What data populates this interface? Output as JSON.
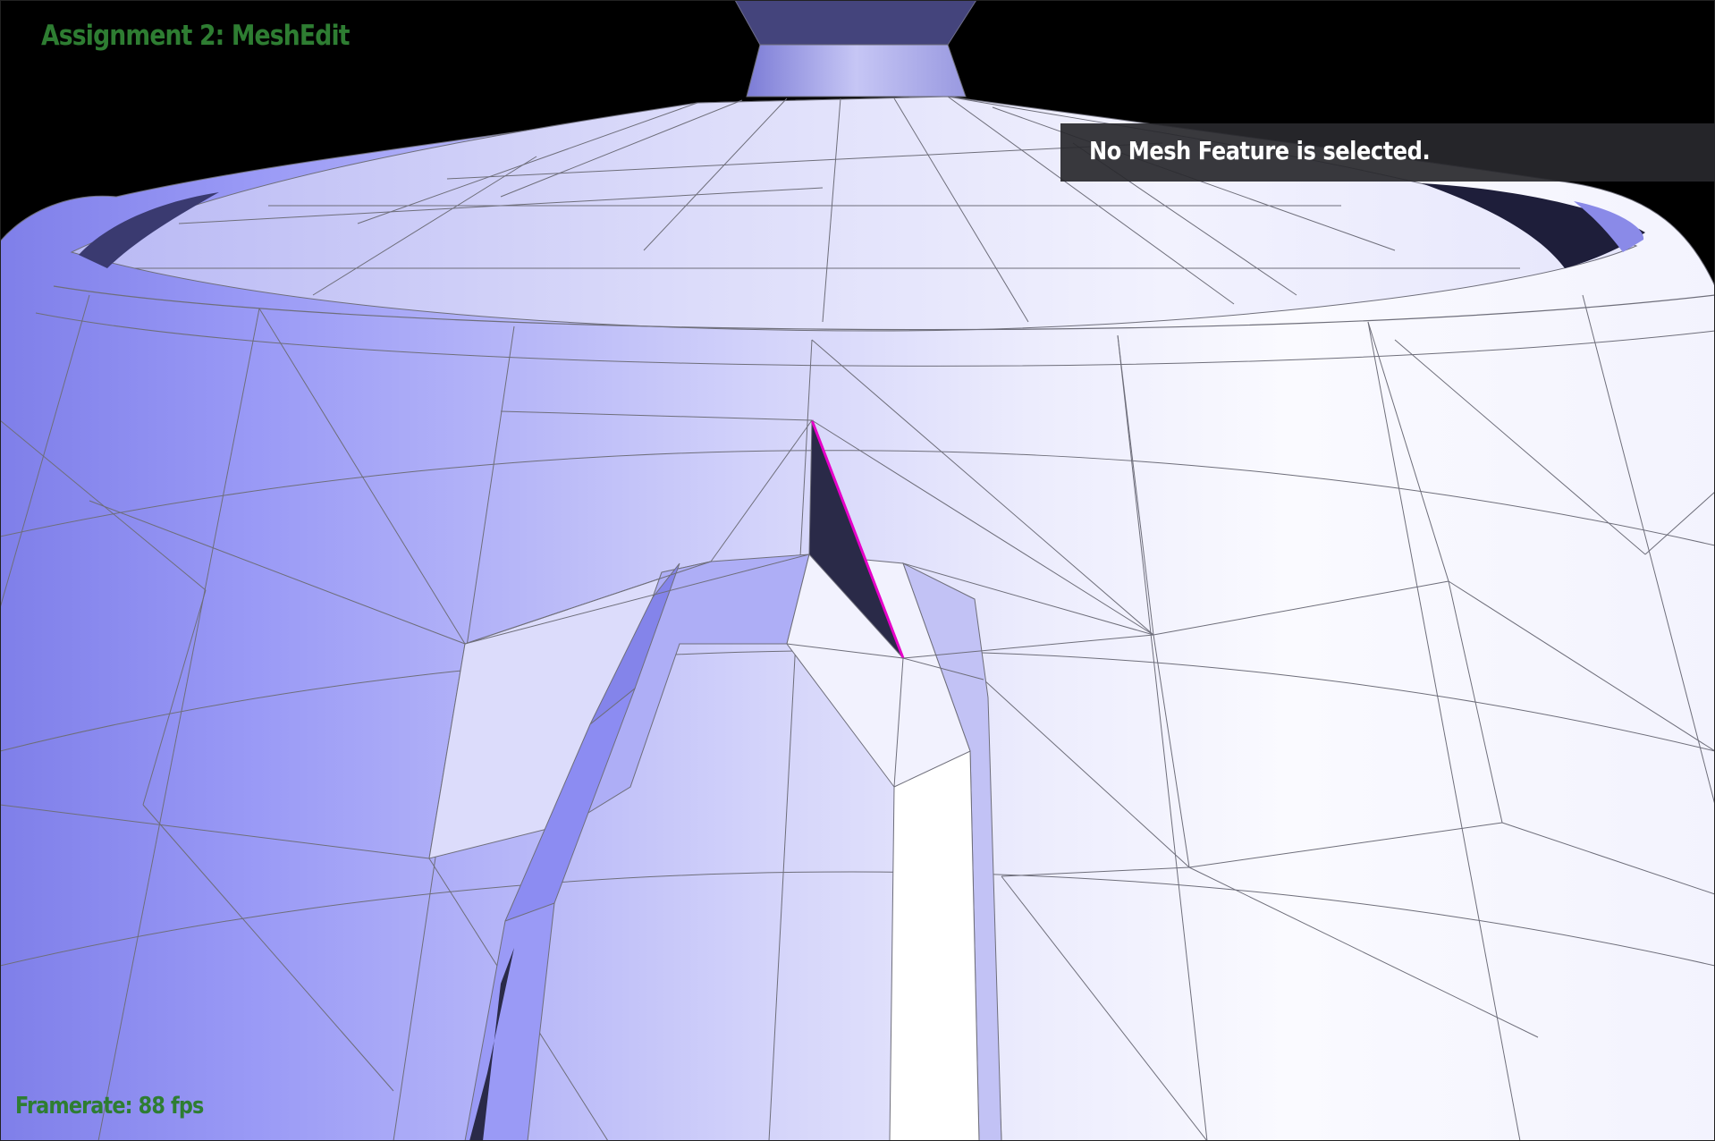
{
  "app": {
    "title": "Assignment 2: MeshEdit",
    "framerate_text": "Framerate: 88 fps",
    "selection_status": "No Mesh Feature is selected."
  },
  "colors": {
    "background": "#000000",
    "hud_text": "#2e7d32",
    "mesh_light": "#f7f7ff",
    "mesh_mid": "#c9c9f7",
    "mesh_dark": "#8d8df5",
    "mesh_shadow": "#2a2a48",
    "wire": "#6e6e7a",
    "highlight_edge": "#e600c8"
  },
  "viewport": {
    "model": "teapot",
    "render_mode": "wireframe-shaded",
    "highlighted_element": "edge"
  }
}
